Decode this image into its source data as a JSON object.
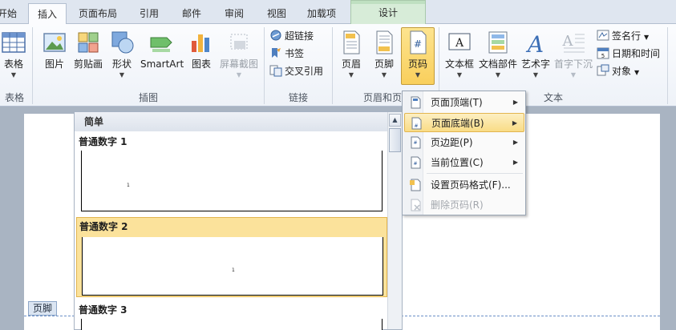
{
  "tabs": [
    {
      "label": "开始",
      "active": false
    },
    {
      "label": "插入",
      "active": true
    },
    {
      "label": "页面布局",
      "active": false
    },
    {
      "label": "引用",
      "active": false
    },
    {
      "label": "邮件",
      "active": false
    },
    {
      "label": "审阅",
      "active": false
    },
    {
      "label": "视图",
      "active": false
    },
    {
      "label": "加载项",
      "active": false
    },
    {
      "label": "设计",
      "active": false
    }
  ],
  "ribbon": {
    "tables": {
      "table_label": "表格",
      "group_label": "表格"
    },
    "illustrations": {
      "picture_label": "图片",
      "clipart_label": "剪贴画",
      "shapes_label": "形状",
      "smartart_label": "SmartArt",
      "chart_label": "图表",
      "screenshot_label": "屏幕截图",
      "group_label": "插图"
    },
    "links": {
      "hyperlink_label": "超链接",
      "bookmark_label": "书签",
      "crossref_label": "交叉引用",
      "group_label": "链接"
    },
    "header_footer": {
      "header_label": "页眉",
      "footer_label": "页脚",
      "pagenum_label": "页码",
      "group_label": "页眉和页脚"
    },
    "text": {
      "textbox_label": "文本框",
      "quickparts_label": "文档部件",
      "wordart_label": "艺术字",
      "dropcap_label": "首字下沉",
      "signature_label": "签名行",
      "datetime_label": "日期和时间",
      "object_label": "对象",
      "group_label": "文本"
    }
  },
  "page_number_menu": {
    "items": [
      {
        "label": "页面顶端(T)",
        "has_submenu": true,
        "enabled": true,
        "highlighted": false
      },
      {
        "label": "页面底端(B)",
        "has_submenu": true,
        "enabled": true,
        "highlighted": true
      },
      {
        "label": "页边距(P)",
        "has_submenu": true,
        "enabled": true,
        "highlighted": false
      },
      {
        "label": "当前位置(C)",
        "has_submenu": true,
        "enabled": true,
        "highlighted": false
      },
      {
        "label": "设置页码格式(F)...",
        "has_submenu": false,
        "enabled": true,
        "highlighted": false
      },
      {
        "label": "删除页码(R)",
        "has_submenu": false,
        "enabled": false,
        "highlighted": false
      }
    ],
    "submenu_arrow": "▶"
  },
  "gallery": {
    "heading": "简单",
    "items": [
      {
        "title": "普通数字 1",
        "sample": "1",
        "alignment": "left",
        "selected": false
      },
      {
        "title": "普通数字 2",
        "sample": "1",
        "alignment": "center",
        "selected": true
      },
      {
        "title": "普通数字 3",
        "sample": "",
        "alignment": "right",
        "selected": false
      }
    ],
    "scroll_up": "▲"
  },
  "document": {
    "footer_tag": "页脚"
  },
  "colors": {
    "accent_highlight": "#f9dc86",
    "gallery_selected": "#fbe29b",
    "design_tab": "#d7ecd8",
    "footer_line": "#6a8fc7"
  }
}
